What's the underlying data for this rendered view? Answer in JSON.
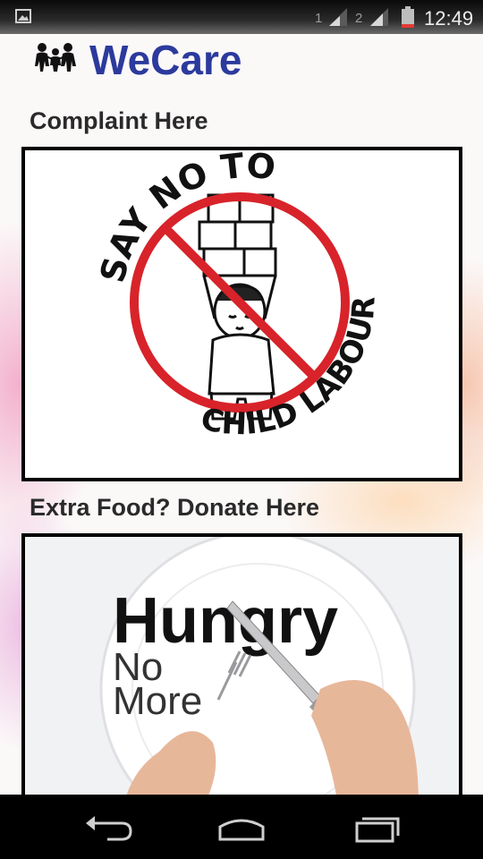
{
  "status_bar": {
    "sim1": "1",
    "sim2": "2",
    "time": "12:49",
    "icons": [
      "gallery-icon",
      "signal-icon",
      "signal-icon",
      "battery-icon"
    ]
  },
  "header": {
    "logo_icon": "family-icon",
    "title": "WeCare"
  },
  "sections": [
    {
      "label": "Complaint Here",
      "image": {
        "top_text": "SAY NO TO",
        "bottom_text": "CHILD LABOUR"
      }
    },
    {
      "label": "Extra Food? Donate Here",
      "image": {
        "line1": "Hungry",
        "line2": "No",
        "line3": "More"
      }
    }
  ],
  "nav_bar": {
    "icons": [
      "back-icon",
      "home-icon",
      "recent-apps-icon"
    ]
  },
  "colors": {
    "title": "#2b3a9c",
    "prohibition_red": "#d8232a"
  }
}
